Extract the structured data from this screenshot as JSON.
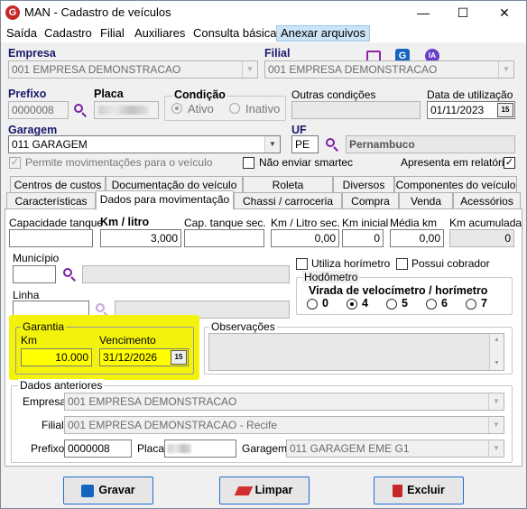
{
  "window": {
    "title": "MAN - Cadastro de veículos",
    "app_icon": "G"
  },
  "menu": [
    "Saída",
    "Cadastro",
    "Filial",
    "Auxiliares",
    "Consulta básica",
    "Anexar arquivos"
  ],
  "toolbar_icons": [
    "monitor-icon",
    "g-app-icon",
    "ia-icon"
  ],
  "ia_label": "IA",
  "header": {
    "empresa_label": "Empresa",
    "empresa_value": "001 EMPRESA DEMONSTRACAO",
    "filial_label": "Filial",
    "filial_value": "001 EMPRESA DEMONSTRACAO",
    "prefixo_label": "Prefixo",
    "prefixo_value": "0000008",
    "placa_label": "Placa",
    "condicao_label": "Condição",
    "ativo_label": "Ativo",
    "inativo_label": "Inativo",
    "outras_label": "Outras condições",
    "data_util_label": "Data de utilização",
    "data_util_value": "01/11/2023",
    "garagem_label": "Garagem",
    "garagem_value": "011 GARAGEM",
    "uf_label": "UF",
    "uf_value": "PE",
    "uf_name": "Pernambuco",
    "permite_label": "Permite movimentações para o veículo",
    "nao_enviar_label": "Não enviar smartec",
    "apresenta_label": "Apresenta em relatórios",
    "cal_glyph": "15"
  },
  "tabs_row1": [
    "Centros de custos",
    "Documentação do veículo",
    "Roleta",
    "Diversos",
    "Componentes do veículo"
  ],
  "tabs_row2": [
    "Características",
    "Dados para movimentação",
    "Chassi / carroceria",
    "Compra",
    "Venda",
    "Acessórios"
  ],
  "panel": {
    "capacidade_label": "Capacidade tanque",
    "capacidade_value": "",
    "km_litro_label": "Km / litro",
    "km_litro_value": "3,000",
    "cap_sec_label": "Cap. tanque sec.",
    "cap_sec_value": "",
    "km_litro_sec_label": "Km / Litro sec.",
    "km_litro_sec_value": "0,00",
    "km_inicial_label": "Km inicial",
    "km_inicial_value": "0",
    "media_km_label": "Média km",
    "media_km_value": "0,00",
    "km_acum_label": "Km acumulada",
    "km_acum_value": "0",
    "municipio_label": "Município",
    "linha_label": "Linha",
    "utiliza_horimetro_label": "Utiliza horímetro",
    "possui_cobrador_label": "Possui cobrador",
    "hodometro_label": "Hodômetro",
    "virada_label": "Virada de velocímetro / horímetro",
    "virada_options": [
      "0",
      "4",
      "5",
      "6",
      "7"
    ],
    "virada_selected": "4",
    "garantia_label": "Garantia",
    "km_label": "Km",
    "km_value": "10.000",
    "vencimento_label": "Vencimento",
    "vencimento_value": "31/12/2026",
    "observacoes_label": "Observações",
    "dados_anteriores_label": "Dados anteriores",
    "ant_empresa_label": "Empresa",
    "ant_empresa_value": "001 EMPRESA DEMONSTRACAO",
    "ant_filial_label": "Filial",
    "ant_filial_value": "001 EMPRESA DEMONSTRACAO - Recife",
    "ant_prefixo_label": "Prefixo",
    "ant_prefixo_value": "0000008",
    "ant_placa_label": "Placa",
    "ant_garagem_label": "Garagem",
    "ant_garagem_value": "011 GARAGEM EME G1"
  },
  "buttons": {
    "gravar": "Gravar",
    "limpar": "Limpar",
    "excluir": "Excluir"
  },
  "window_controls": {
    "minimize": "—",
    "maximize": "☐",
    "close": "✕"
  },
  "colors": {
    "accent": "#1f6fd1",
    "highlight": "#f2f20c",
    "brand": "#c62828",
    "search": "#7b1fa2"
  }
}
